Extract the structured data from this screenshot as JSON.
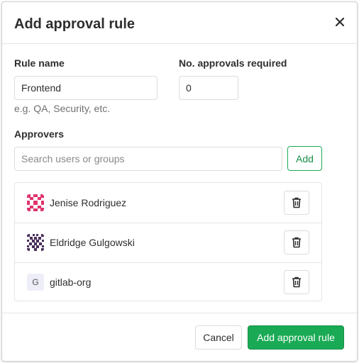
{
  "modal": {
    "title": "Add approval rule"
  },
  "form": {
    "rule_name": {
      "label": "Rule name",
      "value": "Frontend",
      "help": "e.g. QA, Security, etc."
    },
    "approvals_required": {
      "label": "No. approvals required",
      "value": "0"
    },
    "approvers": {
      "label": "Approvers",
      "search_placeholder": "Search users or groups",
      "add_label": "Add"
    }
  },
  "approvers_list": [
    {
      "name": "Jenise Rodriguez",
      "avatar": "identicon-pink"
    },
    {
      "name": "Eldridge Gulgowski",
      "avatar": "identicon-purple"
    },
    {
      "name": "gitlab-org",
      "avatar_letter": "G"
    }
  ],
  "footer": {
    "cancel_label": "Cancel",
    "submit_label": "Add approval rule"
  },
  "colors": {
    "primary_green": "#1aaa55",
    "identicon_pink": "#e0336b",
    "identicon_purple": "#4a2f5a"
  },
  "icons": {
    "close": "close-icon",
    "remove": "trash-icon"
  }
}
